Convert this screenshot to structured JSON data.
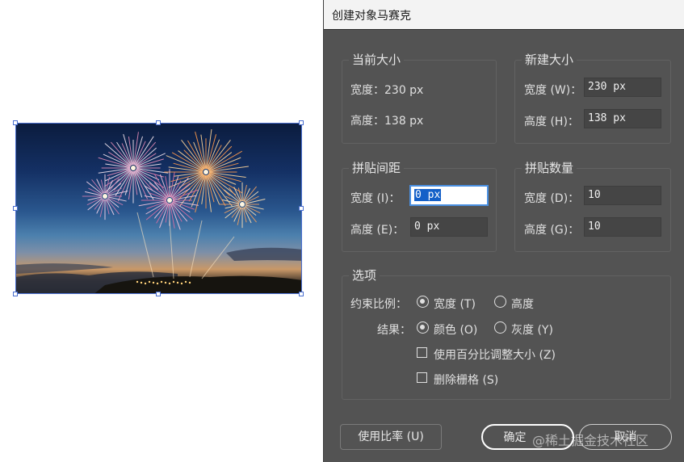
{
  "dialog": {
    "title": "创建对象马赛克",
    "current_size": {
      "title": "当前大小",
      "width_text": "宽度：230 px",
      "height_text": "高度：138 px"
    },
    "new_size": {
      "title": "新建大小",
      "width_label": "宽度 (W)：",
      "width_value": "230 px",
      "height_label": "高度 (H)：",
      "height_value": "138 px"
    },
    "tile_spacing": {
      "title": "拼贴间距",
      "width_label": "宽度 (I)：",
      "width_value": "0 px",
      "height_label": "高度 (E)：",
      "height_value": "0 px"
    },
    "tile_count": {
      "title": "拼贴数量",
      "width_label": "宽度 (D)：",
      "width_value": "10",
      "height_label": "高度 (G)：",
      "height_value": "10"
    },
    "options": {
      "title": "选项",
      "constrain_label": "约束比例：",
      "constrain_width": "宽度 (T)",
      "constrain_height": "高度",
      "constrain_selected": "宽度 (T)",
      "result_label": "结果：",
      "result_color": "颜色 (O)",
      "result_gray": "灰度 (Y)",
      "result_selected": "颜色 (O)",
      "use_percent": "使用百分比调整大小 (Z)",
      "use_percent_checked": false,
      "delete_raster": "删除栅格 (S)",
      "delete_raster_checked": false
    },
    "buttons": {
      "use_ratio": "使用比率 (U)",
      "ok": "确定",
      "cancel": "取消"
    }
  },
  "watermark": "@稀土掘金技术社区",
  "colors": {
    "dialog_bg": "#535353",
    "selection_border": "#4a6fd0",
    "active_field_highlight": "#1460c8"
  }
}
